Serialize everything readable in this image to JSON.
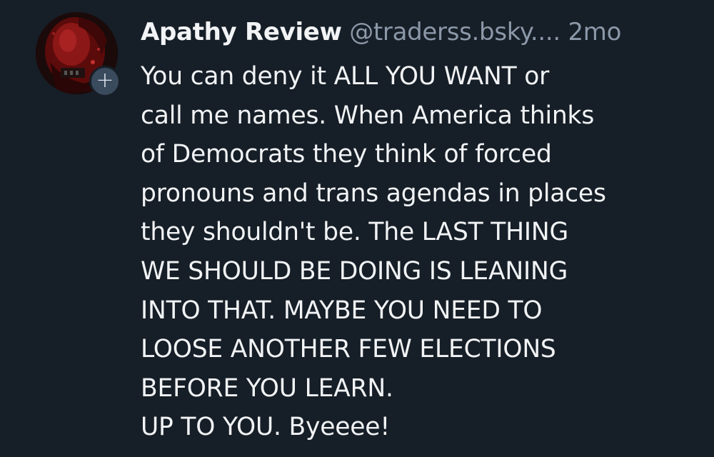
{
  "post": {
    "display_name": "Apathy Review",
    "handle": "@traderss.bsky....",
    "timestamp": "2mo",
    "follow_symbol": "+",
    "avatar_icon": "avatar-image",
    "lines": [
      "You can deny it ALL YOU WANT or",
      "call me names. When America thinks",
      "of Democrats they think of forced",
      "pronouns and trans agendas in places",
      "they shouldn't be. The LAST THING",
      "WE SHOULD BE DOING IS LEANING",
      "INTO THAT. MAYBE YOU NEED TO",
      "LOOSE ANOTHER FEW ELECTIONS",
      "BEFORE YOU LEARN.",
      "UP TO YOU. Byeeee!"
    ]
  },
  "colors": {
    "background": "#161e27",
    "text": "#f1f3f5",
    "muted": "#8b98a8",
    "follow_button": "#3b4b5e"
  }
}
